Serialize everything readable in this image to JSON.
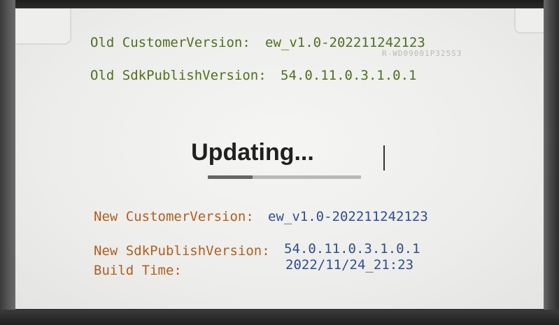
{
  "old": {
    "customer_label": "Old CustomerVersion:",
    "customer_value": "ew_v1.0-202211242123",
    "sdk_label": "Old SdkPublishVersion:",
    "sdk_value": "54.0.11.0.3.1.0.1"
  },
  "overlay_id": "R-WD09001P325S3",
  "status": {
    "title": "Updating...",
    "progress": 0.29
  },
  "new": {
    "customer_label": "New CustomerVersion:",
    "customer_value": "ew_v1.0-202211242123",
    "sdk_label": "New SdkPublishVersion:",
    "sdk_value": "54.0.11.0.3.1.0.1",
    "build_label": "Build Time:",
    "build_value": "2022/11/24_21:23"
  },
  "colors": {
    "old_text": "#4f6f1f",
    "value_text": "#2d4f8f",
    "new_label": "#b05e1e",
    "progress_fill": "#666666",
    "progress_track": "#b9b9b9"
  }
}
